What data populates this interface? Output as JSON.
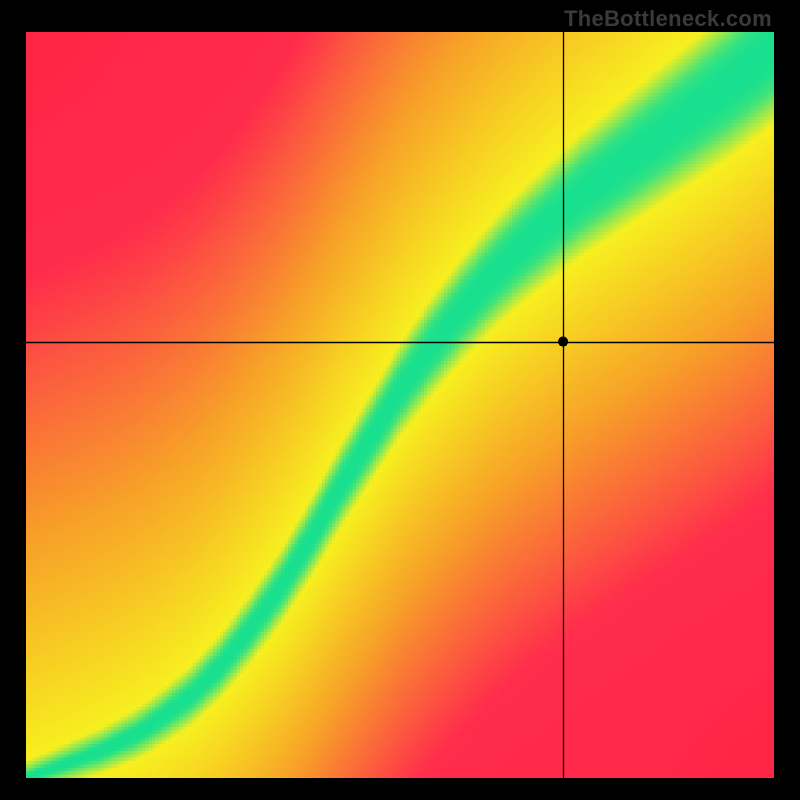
{
  "watermark": "TheBottleneck.com",
  "chart_data": {
    "type": "heatmap",
    "title": "",
    "xlabel": "",
    "ylabel": "",
    "xlim": [
      0,
      1
    ],
    "ylim": [
      0,
      1
    ],
    "crosshair": {
      "x": 0.718,
      "y": 0.585
    },
    "point_radius_px": 5,
    "grid": false,
    "legend": false,
    "ridge": {
      "description": "green optimal band center y as function of x (normalized, y up)",
      "points": [
        [
          0.0,
          0.0
        ],
        [
          0.05,
          0.018
        ],
        [
          0.1,
          0.036
        ],
        [
          0.15,
          0.06
        ],
        [
          0.18,
          0.08
        ],
        [
          0.22,
          0.11
        ],
        [
          0.26,
          0.15
        ],
        [
          0.3,
          0.2
        ],
        [
          0.34,
          0.255
        ],
        [
          0.38,
          0.32
        ],
        [
          0.42,
          0.39
        ],
        [
          0.46,
          0.455
        ],
        [
          0.5,
          0.52
        ],
        [
          0.54,
          0.575
        ],
        [
          0.58,
          0.625
        ],
        [
          0.62,
          0.67
        ],
        [
          0.66,
          0.71
        ],
        [
          0.7,
          0.745
        ],
        [
          0.74,
          0.78
        ],
        [
          0.78,
          0.81
        ],
        [
          0.82,
          0.84
        ],
        [
          0.86,
          0.87
        ],
        [
          0.9,
          0.9
        ],
        [
          0.94,
          0.93
        ],
        [
          0.97,
          0.955
        ],
        [
          1.0,
          0.98
        ]
      ],
      "green_halfwidth_start": 0.008,
      "green_halfwidth_end": 0.06,
      "yellow_extra_start": 0.015,
      "yellow_extra_end": 0.045
    },
    "colors": {
      "green": "#18e08f",
      "yellow": "#f7ef1f",
      "orange_mid": "#f7a028",
      "red": "#ff2d4d",
      "red_deep": "#ff1f3f"
    }
  }
}
